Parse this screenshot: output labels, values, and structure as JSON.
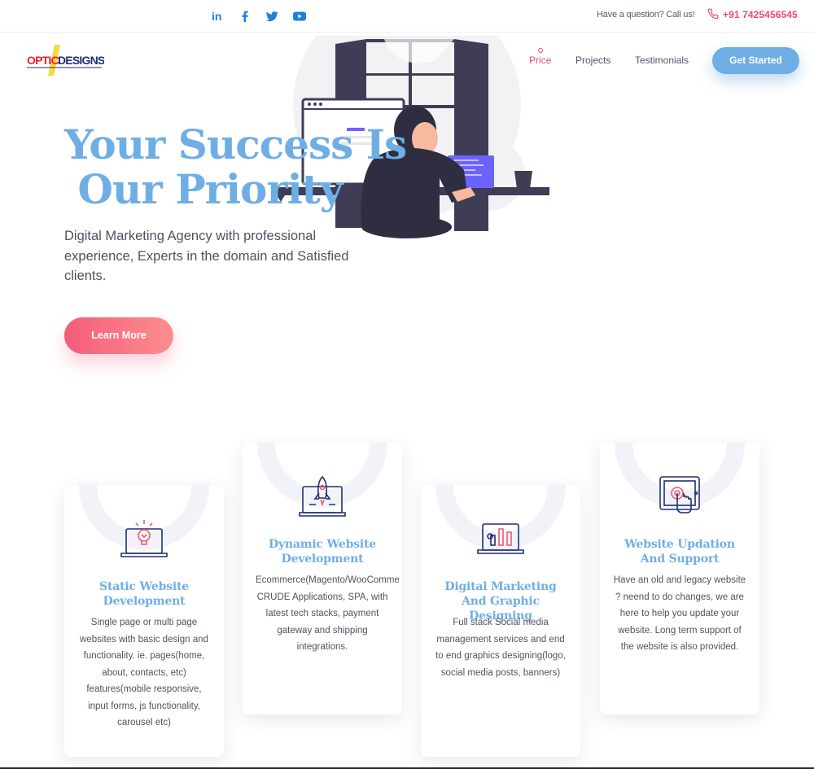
{
  "topbar": {
    "social": [
      "linkedin-icon",
      "facebook-icon",
      "twitter-icon",
      "youtube-icon"
    ],
    "question": "Have a question? Call us!",
    "phone": "+91 7425456545"
  },
  "header": {
    "logo_text_a": "OPTIC",
    "logo_text_b": "DESIGNS",
    "nav": {
      "price": "Price",
      "projects": "Projects",
      "testimonials": "Testimonials"
    },
    "cta": "Get Started"
  },
  "hero": {
    "title_line1": "Your Success Is",
    "title_line2": " Our Priority",
    "subtitle": "Digital Marketing Agency with professional experience, Experts in the domain and Satisfied clients.",
    "button": "Learn More"
  },
  "services": [
    {
      "icon": "lightbulb-laptop-icon",
      "title": "Static Website Development",
      "desc": "Single page or multi page websites with basic design and functionality. ie. pages(home, about, contacts, etc) features(mobile responsive, input forms, js functionality, carousel etc)"
    },
    {
      "icon": "rocket-laptop-icon",
      "title": "Dynamic Website Development",
      "desc_lines": [
        "Ecommerce(Magento/WooComme",
        "CRUDE Applications, SPA, with",
        "latest tech stacks, payment",
        "gateway and shipping",
        "integrations."
      ]
    },
    {
      "icon": "chart-laptop-icon",
      "title": "Digital Marketing And Graphic Designing",
      "desc": "Full stack Social media management services and end to end graphics designing(logo, social media posts, banners)"
    },
    {
      "icon": "touch-tablet-icon",
      "title": "Website Updation And Support",
      "desc": "Have an old and legacy website ? neend to do changes, we are here to help you update your website. Long term support of the website is also provided."
    }
  ],
  "colors": {
    "accent_blue": "#6faee5",
    "accent_pink": "#e84a6f",
    "navy": "#3a4a7a"
  }
}
